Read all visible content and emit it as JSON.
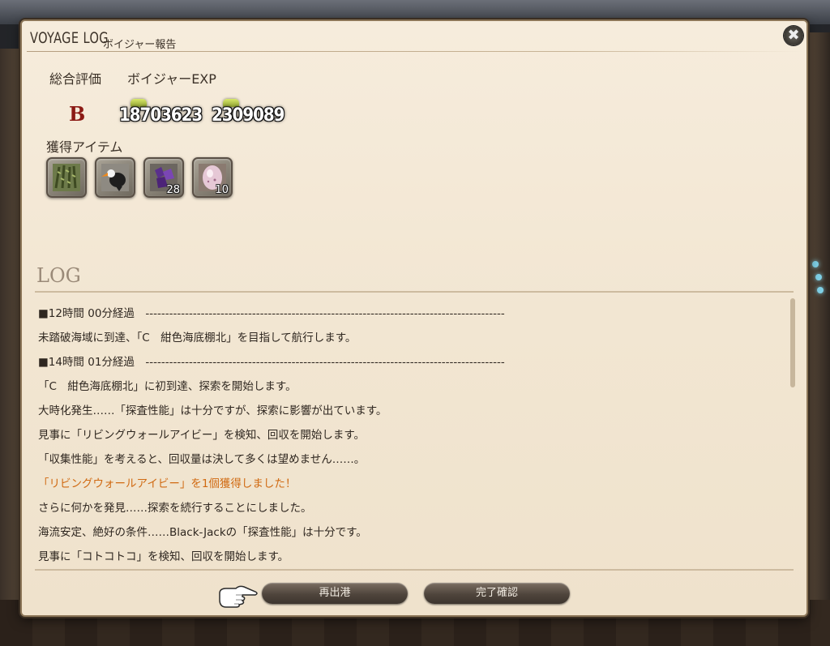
{
  "window": {
    "title": "VOYAGE LOG",
    "subtitle": "ボイジャー報告"
  },
  "summary": {
    "rating_label": "総合評価",
    "exp_label": "ボイジャーEXP",
    "rating": "B",
    "exp_value_1": "18703623",
    "exp_value_2": "2309089"
  },
  "items": {
    "label": "獲得アイテム",
    "list": [
      {
        "icon": "ivy-icon",
        "qty": ""
      },
      {
        "icon": "toucan-icon",
        "qty": ""
      },
      {
        "icon": "purple-crystal-icon",
        "qty": "28"
      },
      {
        "icon": "pearl-icon",
        "qty": "10"
      }
    ]
  },
  "log": {
    "title": "LOG",
    "lines": [
      {
        "text": "■12時間 00分経過　-------------------------------------------------------------------------------------------",
        "color": "normal"
      },
      {
        "text": "未踏破海域に到達、「C　紺色海底棚北」を目指して航行します。",
        "color": "normal"
      },
      {
        "text": "■14時間 01分経過　-------------------------------------------------------------------------------------------",
        "color": "normal"
      },
      {
        "text": "「C　紺色海底棚北」に初到達、探索を開始します。",
        "color": "normal"
      },
      {
        "text": "大時化発生……「探査性能」は十分ですが、探索に影響が出ています。",
        "color": "normal"
      },
      {
        "text": "見事に「リビングウォールアイビー」を検知、回収を開始します。",
        "color": "normal"
      },
      {
        "text": "「収集性能」を考えると、回収量は決して多くは望めません……。",
        "color": "normal"
      },
      {
        "text": "「リビングウォールアイビー」を1個獲得しました！",
        "color": "orange"
      },
      {
        "text": "さらに何かを発見……探索を続行することにしました。",
        "color": "normal"
      },
      {
        "text": "海流安定、絶好の条件……Black-Jackの「探査性能」は十分です。",
        "color": "normal"
      },
      {
        "text": "見事に「コトコトコ」を検知、回収を開始します。",
        "color": "normal"
      }
    ]
  },
  "buttons": {
    "redeploy": "再出港",
    "finalize": "完了確認"
  },
  "colors": {
    "rating": "#8b1a14",
    "highlight": "#d06a12",
    "panel": "#f4e9d6"
  }
}
